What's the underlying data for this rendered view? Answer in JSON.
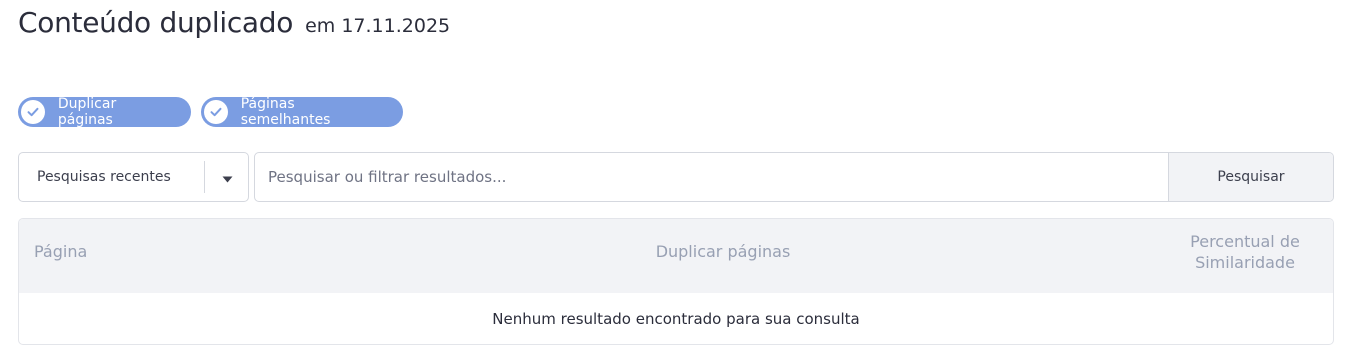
{
  "header": {
    "title": "Conteúdo duplicado",
    "date": "em 17.11.2025"
  },
  "filters": {
    "chips": [
      {
        "label": "Duplicar páginas",
        "checked": true,
        "icon": "check-icon"
      },
      {
        "label": "Páginas semelhantes",
        "checked": true,
        "icon": "check-icon"
      }
    ]
  },
  "search": {
    "recent_label": "Pesquisas recentes",
    "placeholder": "Pesquisar ou filtrar resultados...",
    "value": "",
    "button_label": "Pesquisar"
  },
  "table": {
    "columns": [
      "Página",
      "Duplicar páginas",
      "Percentual de Similaridade"
    ],
    "empty_message": "Nenhum resultado encontrado para sua consulta"
  },
  "colors": {
    "chip_bg": "#7b9de2",
    "header_bg": "#f2f3f6",
    "header_text": "#98a0b3"
  }
}
